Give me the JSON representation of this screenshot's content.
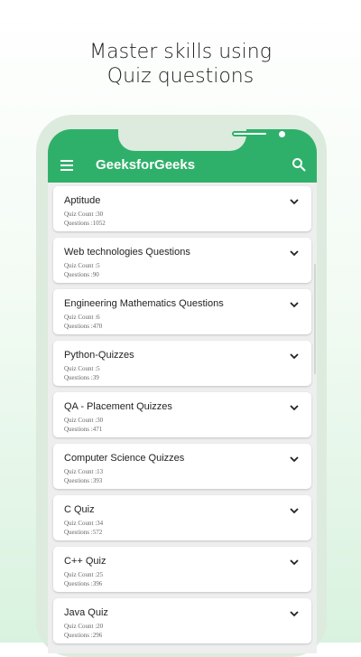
{
  "headline": {
    "line1": "Master skills using",
    "line2": "Quiz questions"
  },
  "app": {
    "title": "GeeksforGeeks",
    "accent_color": "#2fb06a",
    "menu_icon": "hamburger-menu-icon",
    "search_icon": "search-icon"
  },
  "categories": [
    {
      "title": "Aptitude",
      "quiz_count": "Quiz Count :30",
      "questions": "Questions :1052"
    },
    {
      "title": "Web technologies Questions",
      "quiz_count": "Quiz Count :5",
      "questions": "Questions :90"
    },
    {
      "title": "Engineering Mathematics Questions",
      "quiz_count": "Quiz Count :6",
      "questions": "Questions :470"
    },
    {
      "title": "Python-Quizzes",
      "quiz_count": "Quiz Count :5",
      "questions": "Questions :39"
    },
    {
      "title": "QA - Placement Quizzes",
      "quiz_count": "Quiz Count :30",
      "questions": "Questions :471"
    },
    {
      "title": "Computer Science Quizzes",
      "quiz_count": "Quiz Count :13",
      "questions": "Questions :393"
    },
    {
      "title": "C Quiz",
      "quiz_count": "Quiz Count :34",
      "questions": "Questions :572"
    },
    {
      "title": "C++ Quiz",
      "quiz_count": "Quiz Count :25",
      "questions": "Questions :396"
    },
    {
      "title": "Java Quiz",
      "quiz_count": "Quiz Count :20",
      "questions": "Questions :296"
    }
  ]
}
